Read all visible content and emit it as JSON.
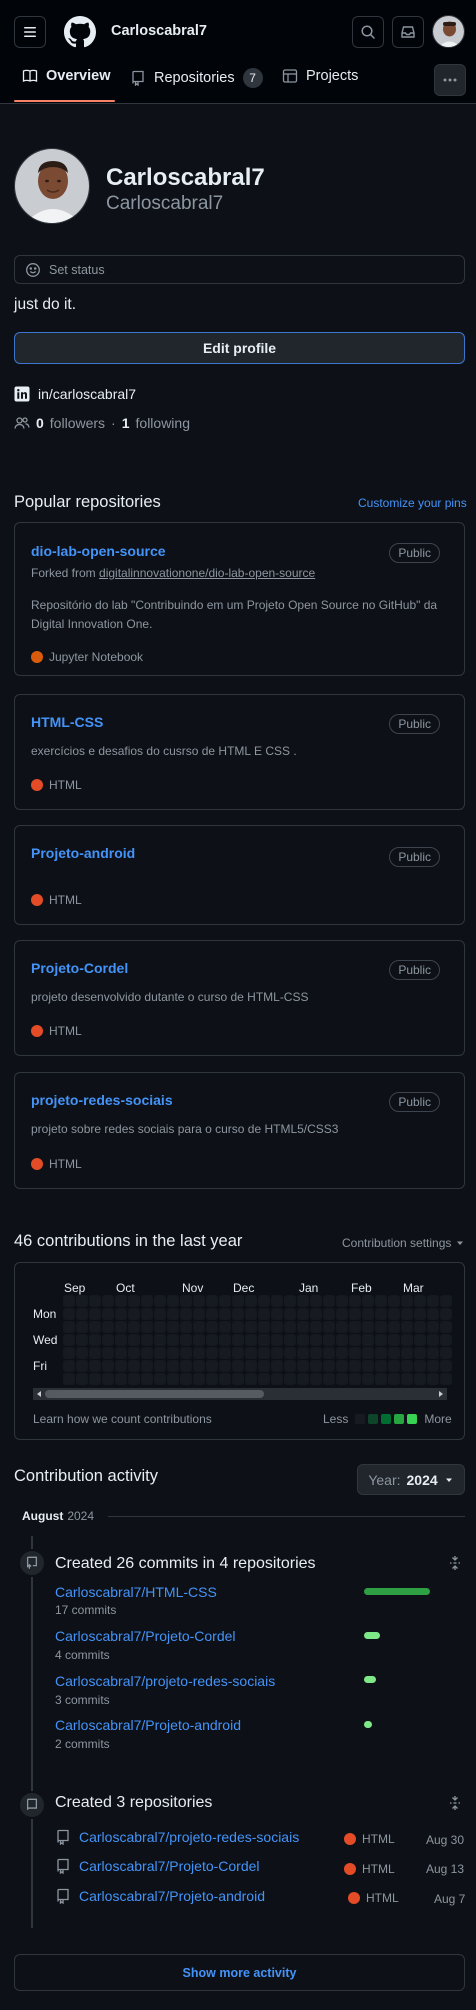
{
  "header": {
    "username": "Carloscabral7",
    "tabs": [
      {
        "label": "Overview"
      },
      {
        "label": "Repositories",
        "count": "7"
      },
      {
        "label": "Projects"
      }
    ]
  },
  "profile": {
    "name": "Carloscabral7",
    "login": "Carloscabral7",
    "status_placeholder": "Set status",
    "bio": "just do it.",
    "edit_label": "Edit profile",
    "social": "in/carloscabral7",
    "followers_count": "0",
    "followers_label": "followers",
    "separator": "·",
    "following_count": "1",
    "following_label": "following"
  },
  "pinned": {
    "title": "Popular repositories",
    "customize": "Customize your pins",
    "repos": [
      {
        "name": "dio-lab-open-source",
        "visibility": "Public",
        "fork_prefix": "Forked from",
        "fork_source": "digitalinnovationone/dio-lab-open-source",
        "desc": "Repositório do lab \"Contribuindo em um Projeto Open Source no GitHub\" da Digital Innovation One.",
        "lang": "Jupyter Notebook",
        "lang_color": "#DA5B0B"
      },
      {
        "name": "HTML-CSS",
        "visibility": "Public",
        "desc": "exercícios e desafios do cusrso de HTML E CSS .",
        "lang": "HTML",
        "lang_color": "#e34c26"
      },
      {
        "name": "Projeto-android",
        "visibility": "Public",
        "desc": "",
        "lang": "HTML",
        "lang_color": "#e34c26"
      },
      {
        "name": "Projeto-Cordel",
        "visibility": "Public",
        "desc": "projeto desenvolvido dutante o curso de HTML-CSS",
        "lang": "HTML",
        "lang_color": "#e34c26"
      },
      {
        "name": "projeto-redes-sociais",
        "visibility": "Public",
        "desc": "projeto sobre redes sociais para o curso de HTML5/CSS3",
        "lang": "HTML",
        "lang_color": "#e34c26"
      }
    ]
  },
  "contributions": {
    "title": "46 contributions in the last year",
    "settings": "Contribution settings",
    "months": [
      "Sep",
      "Oct",
      "Nov",
      "Dec",
      "Jan",
      "Feb",
      "Mar"
    ],
    "days": [
      "Mon",
      "Wed",
      "Fri"
    ],
    "learn": "Learn how we count contributions",
    "less": "Less",
    "more": "More",
    "legend_colors": [
      "#161b22",
      "#0e4429",
      "#006d32",
      "#26a641",
      "#39d353"
    ]
  },
  "activity": {
    "title": "Contribution activity",
    "year_label": "Year:",
    "year": "2024",
    "period_month": "August",
    "period_year": "2024",
    "commits_title": "Created 26 commits in 4 repositories",
    "commits": [
      {
        "repo": "Carloscabral7/HTML-CSS",
        "count": "17 commits",
        "share": 17
      },
      {
        "repo": "Carloscabral7/Projeto-Cordel",
        "count": "4 commits",
        "share": 4
      },
      {
        "repo": "Carloscabral7/projeto-redes-sociais",
        "count": "3 commits",
        "share": 3
      },
      {
        "repo": "Carloscabral7/Projeto-android",
        "count": "2 commits",
        "share": 2
      }
    ],
    "repos_title": "Created 3 repositories",
    "new_repos": [
      {
        "repo": "Carloscabral7/projeto-redes-sociais",
        "lang": "HTML",
        "date": "Aug 30"
      },
      {
        "repo": "Carloscabral7/Projeto-Cordel",
        "lang": "HTML",
        "date": "Aug 13"
      },
      {
        "repo": "Carloscabral7/Projeto-android",
        "lang": "HTML",
        "date": "Aug 7"
      }
    ],
    "lang_color": "#e34c26",
    "show_more": "Show more activity"
  }
}
